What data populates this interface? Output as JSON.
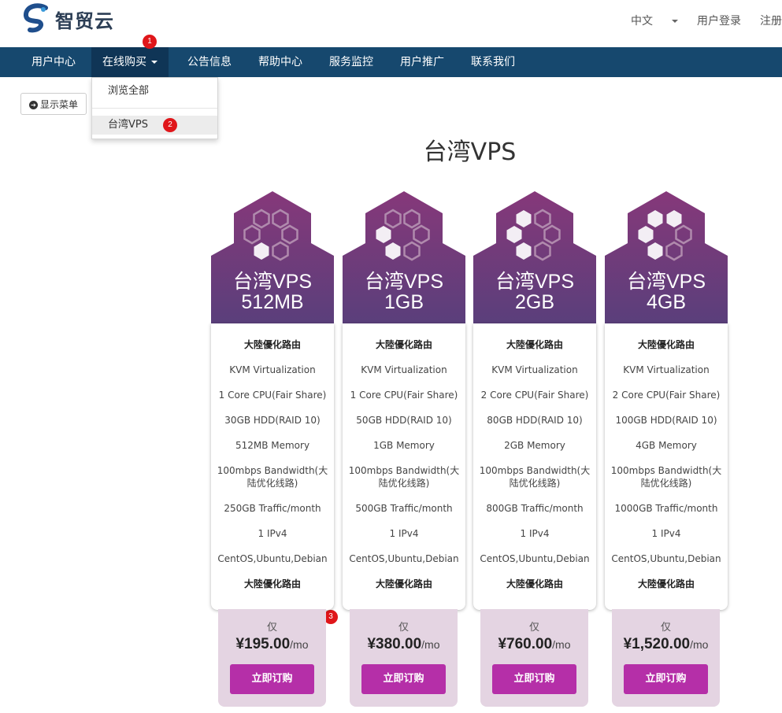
{
  "header": {
    "logo_text": "智贸云",
    "links": [
      {
        "label": "中文",
        "dropdown": true
      },
      {
        "label": "用户登录"
      },
      {
        "label": "注册"
      }
    ]
  },
  "nav": {
    "items": [
      {
        "label": "用户中心"
      },
      {
        "label": "在线购买",
        "dropdown": true,
        "active": true
      },
      {
        "label": "公告信息"
      },
      {
        "label": "帮助中心"
      },
      {
        "label": "服务监控"
      },
      {
        "label": "用户推广"
      },
      {
        "label": "联系我们"
      }
    ]
  },
  "dropdown": {
    "items": [
      {
        "label": "浏览全部"
      },
      {
        "label": "台湾VPS"
      }
    ]
  },
  "annotations": [
    "1",
    "2",
    "3"
  ],
  "show_menu_button": "显示菜单",
  "page_title": "台湾VPS",
  "colors": {
    "nav_bg": "#16486e",
    "nav_active": "#0f3556",
    "card_head": "#5d3d7a",
    "card_foot": "#e4d4e2",
    "buy_button": "#b52fa8",
    "badge": "#e0161a"
  },
  "products": [
    {
      "title_line1": "台湾VPS",
      "title_line2": "512MB",
      "features": [
        "大陸優化路由",
        "KVM Virtualization",
        "1 Core CPU(Fair Share)",
        "30GB HDD(RAID 10)",
        "512MB Memory",
        "100mbps Bandwidth(大陆优化线路)",
        "250GB Traffic/month",
        "1 IPv4",
        "CentOS,Ubuntu,Debian",
        "大陸優化路由"
      ],
      "only": "仅",
      "price": "¥195.00",
      "per": "/mo",
      "buy_label": "立即订购",
      "filled_hexes": 1
    },
    {
      "title_line1": "台湾VPS",
      "title_line2": "1GB",
      "features": [
        "大陸優化路由",
        "KVM Virtualization",
        "1 Core CPU(Fair Share)",
        "50GB HDD(RAID 10)",
        "1GB Memory",
        "100mbps Bandwidth(大陆优化线路)",
        "500GB Traffic/month",
        "1 IPv4",
        "CentOS,Ubuntu,Debian",
        "大陸優化路由"
      ],
      "only": "仅",
      "price": "¥380.00",
      "per": "/mo",
      "buy_label": "立即订购",
      "filled_hexes": 2
    },
    {
      "title_line1": "台湾VPS",
      "title_line2": "2GB",
      "features": [
        "大陸優化路由",
        "KVM Virtualization",
        "2 Core CPU(Fair Share)",
        "80GB HDD(RAID 10)",
        "2GB Memory",
        "100mbps Bandwidth(大陆优化线路)",
        "800GB Traffic/month",
        "1 IPv4",
        "CentOS,Ubuntu,Debian",
        "大陸優化路由"
      ],
      "only": "仅",
      "price": "¥760.00",
      "per": "/mo",
      "buy_label": "立即订购",
      "filled_hexes": 3
    },
    {
      "title_line1": "台湾VPS",
      "title_line2": "4GB",
      "features": [
        "大陸優化路由",
        "KVM Virtualization",
        "2 Core CPU(Fair Share)",
        "100GB HDD(RAID 10)",
        "4GB Memory",
        "100mbps Bandwidth(大陆优化线路)",
        "1000GB Traffic/month",
        "1 IPv4",
        "CentOS,Ubuntu,Debian",
        "大陸優化路由"
      ],
      "only": "仅",
      "price": "¥1,520.00",
      "per": "/mo",
      "buy_label": "立即订购",
      "filled_hexes": 4
    }
  ]
}
